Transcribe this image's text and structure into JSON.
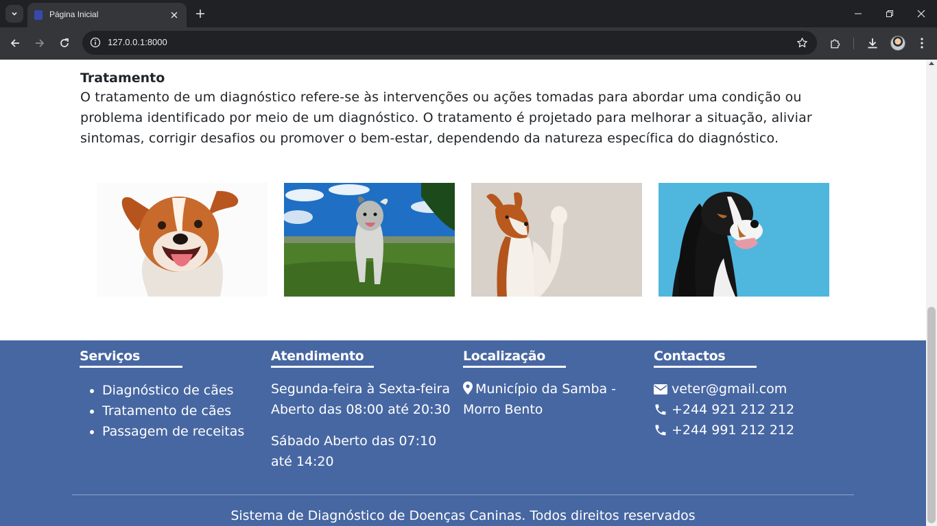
{
  "browser": {
    "tab_title": "Página Inicial",
    "url": "127.0.0.1:8000"
  },
  "content": {
    "heading": "Tratamento",
    "paragraph": "O tratamento de um diagnóstico refere-se às intervenções ou ações tomadas para abordar uma condição ou problema identificado por meio de um diagnóstico. O tratamento é projetado para melhorar a situação, aliviar sintomas, corrigir desafios ou promover o bem-estar, dependendo da natureza específica do diagnóstico."
  },
  "footer": {
    "services": {
      "title": "Serviços",
      "items": [
        "Diagnóstico de cães",
        "Tratamento de cães",
        "Passagem de receitas"
      ]
    },
    "hours": {
      "title": "Atendimento",
      "weekdays": "Segunda-feira à Sexta-feira Aberto das 08:00 até 20:30",
      "saturday": "Sábado Aberto das 07:10 até 14:20"
    },
    "location": {
      "title": "Localização",
      "address": "Município da Samba - Morro Bento"
    },
    "contacts": {
      "title": "Contactos",
      "email": "veter@gmail.com",
      "phone1": "+244 921 212 212",
      "phone2": "+244 991 212 212"
    },
    "copyright": "Sistema de Diagnóstico de Doenças Caninas. Todos direitos reservados"
  },
  "colors": {
    "footer_bg": "#4767a2",
    "chrome_dark": "#202124",
    "chrome_toolbar": "#35363a"
  }
}
